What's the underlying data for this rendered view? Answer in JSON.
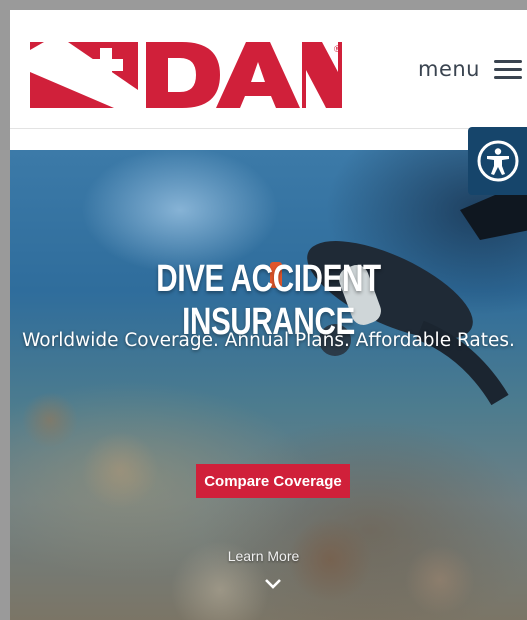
{
  "brand": {
    "name": "DAN",
    "registered": "®",
    "color": "#d0203a"
  },
  "header": {
    "menu_label": "menu",
    "menu_icon": "hamburger-icon"
  },
  "accessibility": {
    "icon": "accessibility-icon",
    "color": "#16456b"
  },
  "hero": {
    "title": "DIVE ACCIDENT INSURANCE",
    "subtitle": "Worldwide Coverage. Annual Plans. Affordable Rates.",
    "cta_label": "Compare Coverage",
    "learn_more_label": "Learn More",
    "scroll_icon": "chevron-down-icon"
  }
}
